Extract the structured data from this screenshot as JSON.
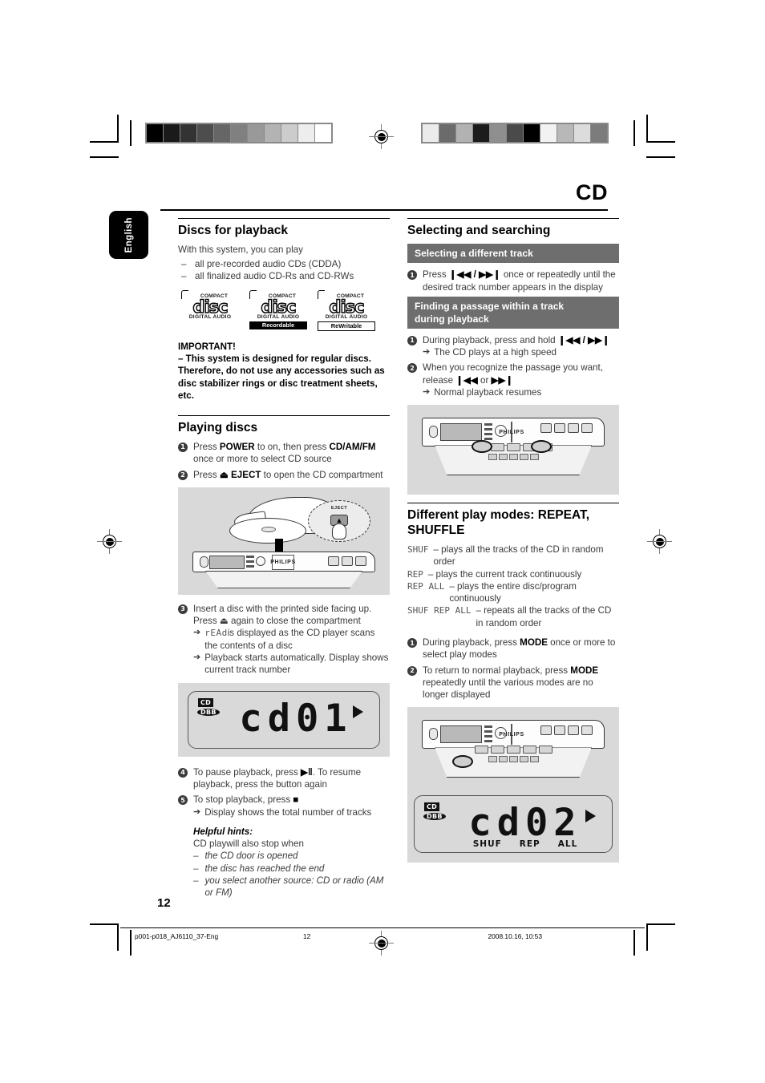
{
  "header": {
    "chapter_title": "CD",
    "language_tab": "English"
  },
  "calibration": {
    "left_bar": [
      "#000000",
      "#1a1a1a",
      "#333333",
      "#4d4d4d",
      "#666666",
      "#808080",
      "#999999",
      "#b3b3b3",
      "#cccccc",
      "#ededed",
      "#ffffff"
    ],
    "right_bar": [
      "#ebebeb",
      "#6b6b6b",
      "#b2b2b2",
      "#1c1c1c",
      "#8f8f8f",
      "#4a4a4a",
      "#000000",
      "#f2f2f2",
      "#b8b8b8",
      "#dcdcdc",
      "#7c7c7c"
    ]
  },
  "left_column": {
    "discs_heading": "Discs for playback",
    "discs_lead": "With this system, you can play",
    "discs_items": [
      "all pre-recorded audio CDs (CDDA)",
      "all finalized audio CD-Rs and CD-RWs"
    ],
    "logos": [
      {
        "compact": "COMPACT",
        "disc": "disc",
        "digital_audio": "DIGITAL AUDIO",
        "tag": "",
        "tag_style": "none"
      },
      {
        "compact": "COMPACT",
        "disc": "disc",
        "digital_audio": "DIGITAL AUDIO",
        "tag": "Recordable",
        "tag_style": "black"
      },
      {
        "compact": "COMPACT",
        "disc": "disc",
        "digital_audio": "DIGITAL AUDIO",
        "tag": "ReWritable",
        "tag_style": "white"
      }
    ],
    "important_heading": "IMPORTANT!",
    "important_body": "–  This system is designed for regular discs. Therefore, do not use any accessories such as disc stabilizer rings or disc treatment sheets, etc.",
    "playing_heading": "Playing discs",
    "steps": [
      {
        "num": "1",
        "pre": "Press ",
        "b1": "POWER",
        "mid": " to on, then press ",
        "b2": "CD/AM/FM",
        "post": " once or more to select CD source"
      },
      {
        "num": "2",
        "pre": "Press ",
        "b1": "⏏ EJECT",
        "mid": "",
        "b2": "",
        "post": " to open the CD compartment"
      }
    ],
    "step3": {
      "num": "3",
      "text": "Insert a disc with the printed side facing up. Press ⏏ again to close the compartment",
      "arrows": [
        {
          "seg": "rEAd",
          "rest": "is displayed as the CD player scans the contents of a disc"
        },
        {
          "seg": "",
          "rest": "Playback starts automatically. Display shows current track number"
        }
      ]
    },
    "display1": {
      "cd_indicator": "CD",
      "dbb_indicator": "DBB",
      "value": "cd01",
      "modes": []
    },
    "step4": {
      "num": "4",
      "pre": "To pause playback, press ",
      "symbol": "▶‖",
      "post": ". To resume playback, press the button again"
    },
    "step5": {
      "num": "5",
      "pre": "To stop playback, press ",
      "symbol": "■",
      "post": "",
      "arrow": "Display shows the total number of tracks"
    },
    "hints_heading": "Helpful hints:",
    "hints_lead": "CD playwill also stop when",
    "hints_items": [
      "the CD door is opened",
      "the disc has reached the end",
      "you select another source: CD or radio (AM or FM)"
    ]
  },
  "right_column": {
    "selecting_heading": "Selecting and searching",
    "subbar1": "Selecting a different track",
    "sel_step1": {
      "num": "1",
      "pre": "Press ",
      "sym1": "❙◀◀",
      "slash": " / ",
      "sym2": "▶▶❙",
      "post": " once or repeatedly until the desired track number appears in the display"
    },
    "subbar2_line1": "Finding a passage within a track",
    "subbar2_line2": "during playback",
    "find_step1": {
      "num": "1",
      "pre": "During playback, press and hold ",
      "sym1": "❙◀◀",
      "slash": " / ",
      "sym2": "▶▶❙",
      "arrow": "The CD plays at a high speed"
    },
    "find_step2": {
      "num": "2",
      "pre": "When you recognize the passage you want, release ",
      "sym1": "❙◀◀",
      "slash": " or ",
      "sym2": "▶▶❙",
      "arrow": "Normal playback resumes"
    },
    "modes_heading_line1": "Different play modes: REPEAT,",
    "modes_heading_line2": "SHUFFLE",
    "mode_defs": [
      {
        "key": "SHUF",
        "desc": "– plays all the tracks of the CD in random order"
      },
      {
        "key": "REP",
        "desc": "– plays the current track continuously"
      },
      {
        "key": "REP ALL",
        "desc": "– plays the entire disc/program continuously"
      },
      {
        "key": "SHUF REP ALL",
        "desc": "– repeats all the tracks of the CD in random order"
      }
    ],
    "mode_step1": {
      "num": "1",
      "pre": "During playback, press ",
      "b": "MODE",
      "post": " once or more to select play modes"
    },
    "mode_step2": {
      "num": "2",
      "pre": "To return to normal playback, press ",
      "b": "MODE",
      "post": " repeatedly until the various modes are no longer displayed"
    },
    "display2": {
      "cd_indicator": "CD",
      "dbb_indicator": "DBB",
      "value": "cd02",
      "modes": [
        "SHUF",
        "REP",
        "ALL"
      ]
    },
    "device_brand": "PHILIPS"
  },
  "footer": {
    "page_number": "12",
    "file_name": "p001-p018_AJ6110_37-Eng",
    "page_ref": "12",
    "timestamp": "2008.10.16, 10:53"
  }
}
